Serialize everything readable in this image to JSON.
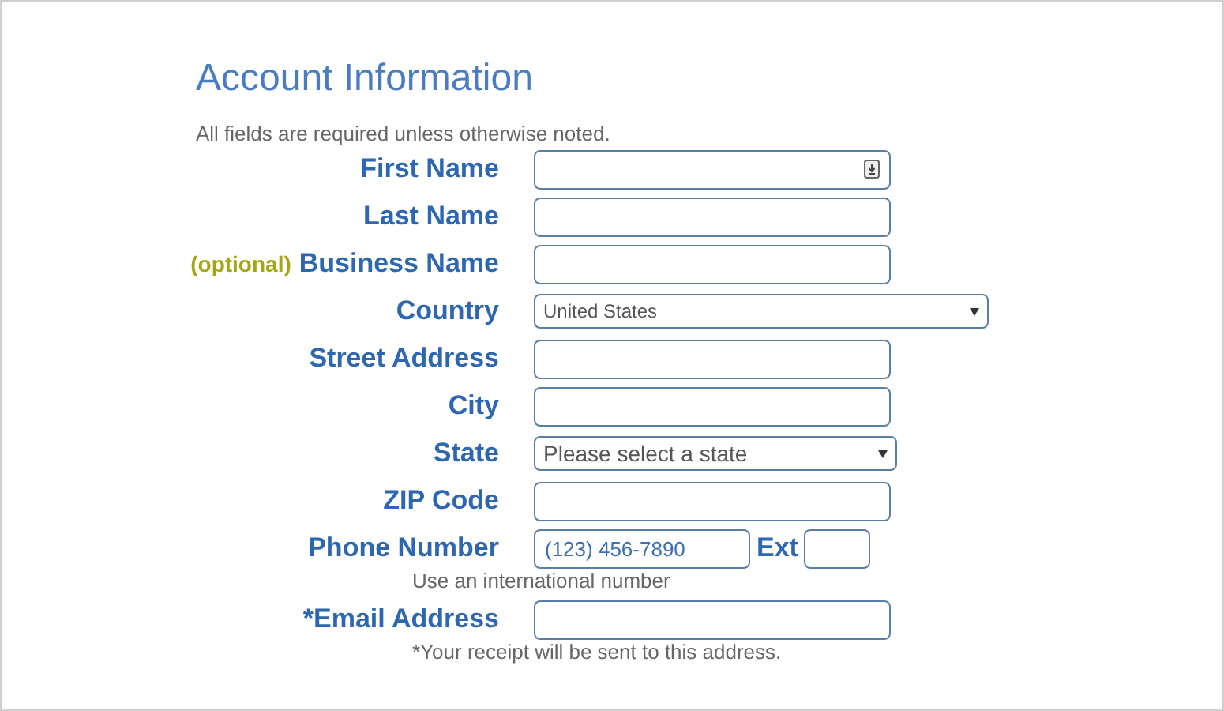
{
  "title": "Account Information",
  "note": "All fields are required unless otherwise noted.",
  "fields": [
    {
      "kind": "text",
      "label": "First Name",
      "autofill_icon": true
    },
    {
      "kind": "text",
      "label": "Last Name"
    },
    {
      "kind": "text",
      "label": "Business Name",
      "optional_tag": "(optional)"
    },
    {
      "kind": "wideselect",
      "label": "Country",
      "value": "United States"
    },
    {
      "kind": "text",
      "label": "Street Address"
    },
    {
      "kind": "text",
      "label": "City"
    },
    {
      "kind": "select",
      "label": "State",
      "value": "Please select a state"
    },
    {
      "kind": "text",
      "label": "ZIP Code"
    },
    {
      "kind": "phone",
      "label": "Phone Number",
      "value": "(123) 456-7890",
      "ext_label": "Ext",
      "hint": "Use an international number"
    },
    {
      "kind": "text",
      "label": "*Email Address",
      "hint": "*Your receipt will be sent to this address."
    }
  ]
}
